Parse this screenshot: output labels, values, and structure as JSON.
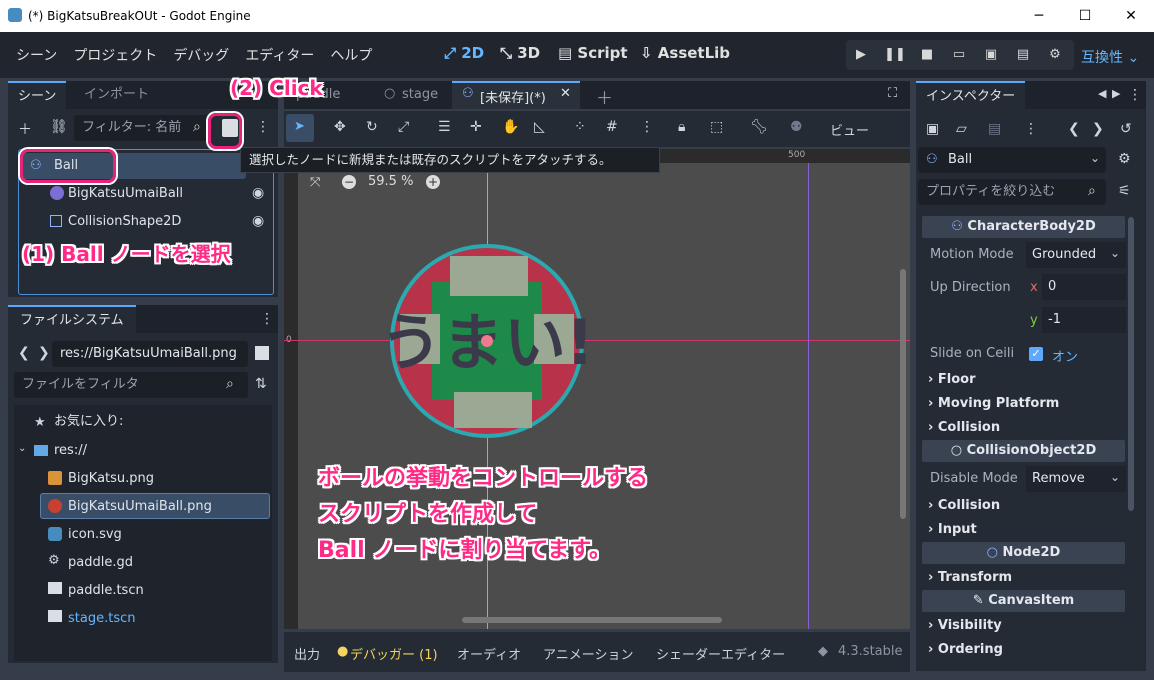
{
  "window": {
    "title": "(*) BigKatsuBreakOUt - Godot Engine",
    "minimize": "─",
    "maximize": "☐",
    "close": "✕"
  },
  "menu": [
    "シーン",
    "プロジェクト",
    "デバッグ",
    "エディター",
    "ヘルプ"
  ],
  "workspaces": {
    "w2d": "⤢ 2D",
    "w3d": "⤡ 3D",
    "script": "Script",
    "assetlib": "⇩ AssetLib"
  },
  "compat": "互換性 ⌄",
  "scene_dock": {
    "tabs": [
      "シーン",
      "インポート"
    ],
    "filter_placeholder": "フィルター: 名前",
    "nodes": [
      {
        "name": "Ball"
      },
      {
        "name": "BigKatsuUmaiBall"
      },
      {
        "name": "CollisionShape2D"
      }
    ]
  },
  "fs_dock": {
    "tab": "ファイルシステム",
    "path": "res://BigKatsuUmaiBall.png",
    "filter_placeholder": "ファイルをフィルタ",
    "favorites": "お気に入り:",
    "root": "res://",
    "files": [
      "BigKatsu.png",
      "BigKatsuUmaiBall.png",
      "icon.svg",
      "paddle.gd",
      "paddle.tscn",
      "stage.tscn"
    ]
  },
  "editor_tabs": [
    "paddle",
    "stage",
    "[未保存](*)"
  ],
  "viewport": {
    "zoom": "59.5 %",
    "ruler_mark": "500",
    "ruler_zero": "0",
    "view_menu": "ビュー"
  },
  "tooltip": "選択したノードに新規または既存のスクリプトをアタッチする。",
  "bottom_bar": {
    "output": "出力",
    "debugger": "デバッガー (1)",
    "audio": "オーディオ",
    "animation": "アニメーション",
    "shader": "シェーダーエディター",
    "version": "4.3.stable"
  },
  "inspector": {
    "tab": "インスペクター",
    "node": "Ball",
    "filter_placeholder": "プロパティを絞り込む",
    "sections": {
      "character_body": "CharacterBody2D",
      "collision_object": "CollisionObject2D",
      "node2d": "Node2D",
      "canvas_item": "CanvasItem"
    },
    "props": {
      "motion_mode_label": "Motion Mode",
      "motion_mode": "Grounded",
      "up_dir_label": "Up Direction",
      "up_x": "0",
      "up_y": "-1",
      "slide_label": "Slide on Ceili",
      "slide_val": "オン",
      "disable_mode_label": "Disable Mode",
      "disable_mode": "Remove"
    },
    "groups": {
      "floor": "Floor",
      "moving": "Moving Platform",
      "collision1": "Collision",
      "collision2": "Collision",
      "input": "Input",
      "transform": "Transform",
      "visibility": "Visibility",
      "ordering": "Ordering"
    }
  },
  "annotations": {
    "step1": "(1) Ball ノードを選択",
    "step2": "(2) Click",
    "desc1": "ボールの挙動をコントロールする",
    "desc2": "スクリプトを作成して",
    "desc3": "Ball ノードに割り当てます。"
  },
  "ball_text": "うまい!"
}
